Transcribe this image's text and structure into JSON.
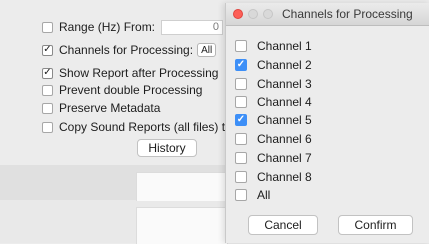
{
  "settings": {
    "range_label": "Range (Hz) From:",
    "range_from_value": "0",
    "channels_label": "Channels for Processing:",
    "channels_value": "All",
    "show_report_label": "Show Report after Processing",
    "prevent_double_label": "Prevent double Processing",
    "preserve_metadata_label": "Preserve Metadata",
    "copy_reports_label": "Copy Sound Reports (all files) to",
    "history_button": "History",
    "checked": {
      "range": false,
      "channels": true,
      "show_report": true,
      "prevent_double": false,
      "preserve_metadata": false,
      "copy_reports": false
    }
  },
  "dialog": {
    "title": "Channels for Processing",
    "channels": [
      {
        "label": "Channel 1",
        "checked": false
      },
      {
        "label": "Channel 2",
        "checked": true
      },
      {
        "label": "Channel 3",
        "checked": false
      },
      {
        "label": "Channel 4",
        "checked": false
      },
      {
        "label": "Channel 5",
        "checked": true
      },
      {
        "label": "Channel 6",
        "checked": false
      },
      {
        "label": "Channel 7",
        "checked": false
      },
      {
        "label": "Channel 8",
        "checked": false
      },
      {
        "label": "All",
        "checked": false
      }
    ],
    "cancel_button": "Cancel",
    "confirm_button": "Confirm"
  },
  "colors": {
    "window_bg": "#ececec",
    "checkbox_accent": "#3d8ff7",
    "close_button": "#fd5f57"
  },
  "icons": {
    "checkmark": "✓"
  }
}
